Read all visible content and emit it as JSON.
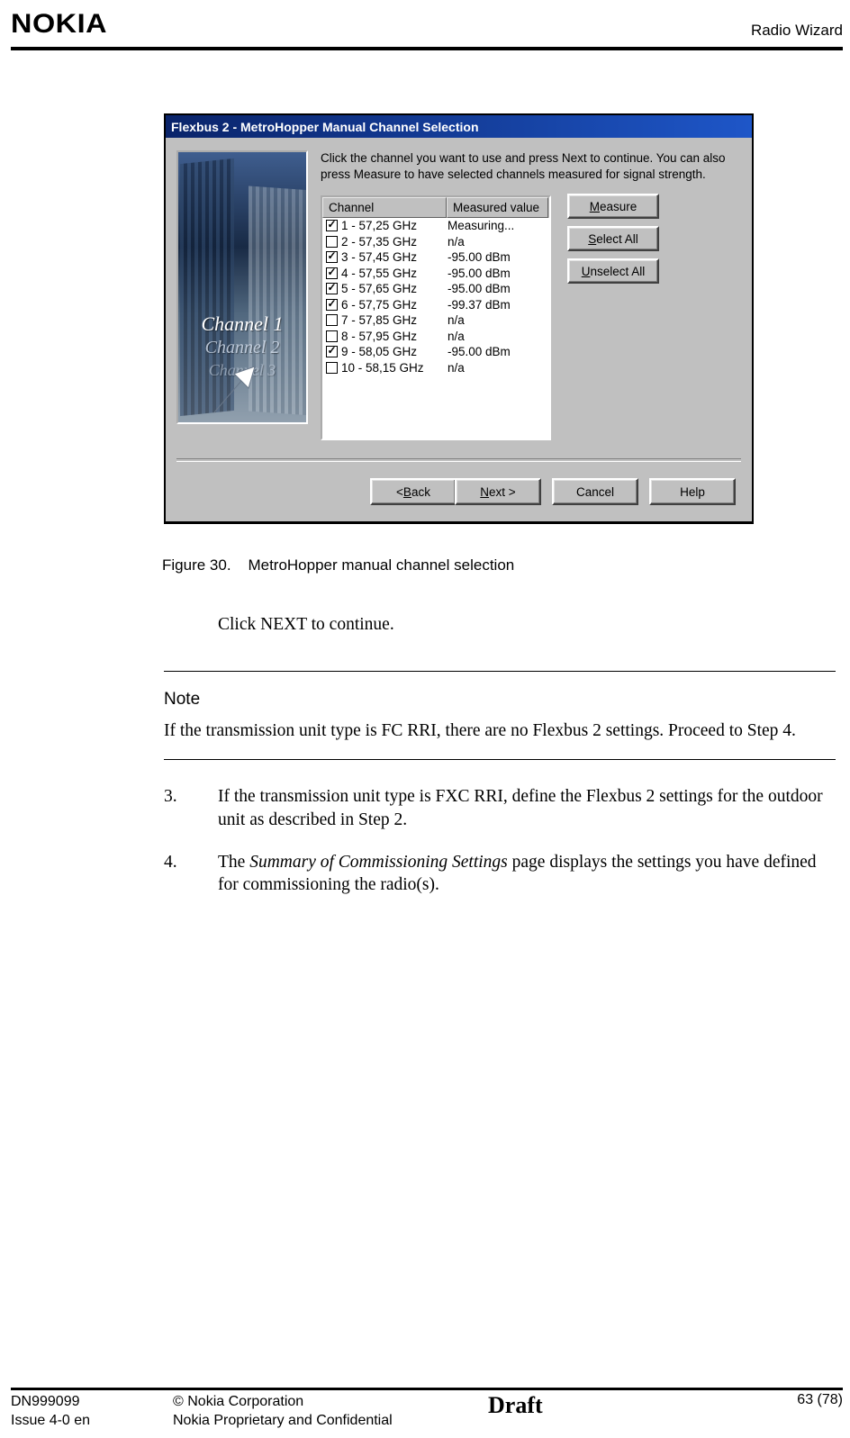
{
  "header": {
    "logo": "NOKIA",
    "section": "Radio Wizard"
  },
  "figure": {
    "title": "Flexbus 2 - MetroHopper Manual Channel Selection",
    "instruction": "Click the channel you want to use and press Next to continue. You can also press Measure to have selected channels measured for signal strength.",
    "image_labels": {
      "l1": "Channel 1",
      "l2": "Channel 2",
      "l3": "Channel 3"
    },
    "columns": {
      "c1": "Channel",
      "c2": "Measured value"
    },
    "rows": [
      {
        "checked": true,
        "channel": "1 - 57,25 GHz",
        "value": "Measuring..."
      },
      {
        "checked": false,
        "channel": "2 - 57,35 GHz",
        "value": "n/a"
      },
      {
        "checked": true,
        "channel": "3 - 57,45 GHz",
        "value": "-95.00 dBm"
      },
      {
        "checked": true,
        "channel": "4 - 57,55 GHz",
        "value": "-95.00 dBm"
      },
      {
        "checked": true,
        "channel": "5 - 57,65 GHz",
        "value": "-95.00 dBm"
      },
      {
        "checked": true,
        "channel": "6 - 57,75 GHz",
        "value": "-99.37 dBm"
      },
      {
        "checked": false,
        "channel": "7 - 57,85 GHz",
        "value": "n/a"
      },
      {
        "checked": false,
        "channel": "8 - 57,95 GHz",
        "value": "n/a"
      },
      {
        "checked": true,
        "channel": "9 - 58,05 GHz",
        "value": "-95.00 dBm"
      },
      {
        "checked": false,
        "channel": "10 - 58,15 GHz",
        "value": "n/a"
      }
    ],
    "side_buttons": {
      "measure_pre": "",
      "measure_u": "M",
      "measure_post": "easure",
      "selectall_pre": "",
      "selectall_u": "S",
      "selectall_post": "elect All",
      "unselectall_pre": "",
      "unselectall_u": "U",
      "unselectall_post": "nselect All"
    },
    "wizard_buttons": {
      "back_pre": "< ",
      "back_u": "B",
      "back_post": "ack",
      "next_pre": "",
      "next_u": "N",
      "next_post": "ext >",
      "cancel": "Cancel",
      "help": "Help"
    },
    "caption_label": "Figure 30.",
    "caption_text": "MetroHopper manual channel selection"
  },
  "body": {
    "click_next": "Click NEXT to continue.",
    "note_head": "Note",
    "note_body": "If the transmission unit type is FC RRI, there are no Flexbus 2 settings. Proceed to Step 4.",
    "steps": [
      {
        "n": "3.",
        "t": "If the transmission unit type is FXC RRI, define the Flexbus 2 settings for the outdoor unit as described in Step 2."
      },
      {
        "n": "4.",
        "t_pre": "The ",
        "t_i": "Summary of Commissioning Settings",
        "t_post": " page displays the settings you have defined for commissioning the radio(s)."
      }
    ]
  },
  "footer": {
    "doc_id": "DN999099",
    "issue": "Issue 4-0 en",
    "copyright": "© Nokia Corporation",
    "classification": "Nokia Proprietary and Confidential",
    "draft": "Draft",
    "page": "63 (78)"
  }
}
